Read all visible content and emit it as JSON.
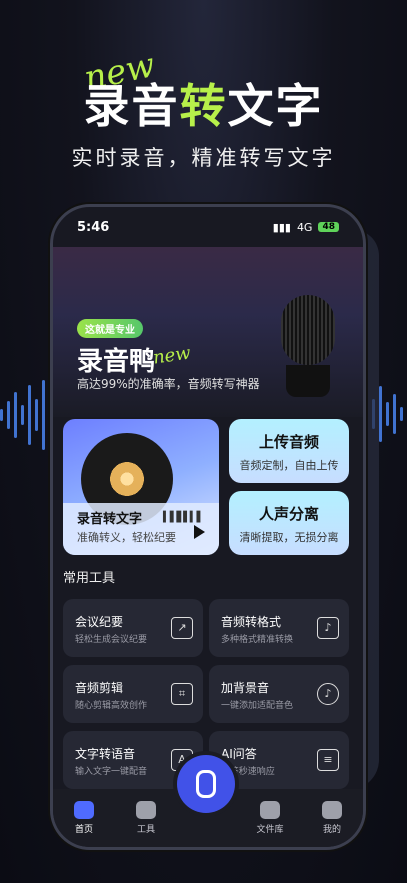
{
  "promo": {
    "title_prefix": "录音",
    "title_accent": "转",
    "title_suffix": "文字",
    "new_badge": "new",
    "subtitle": "实时录音，精准转写文字"
  },
  "status": {
    "time": "5:46",
    "network": "4G",
    "battery": "48"
  },
  "banner": {
    "tag": "这就是专业",
    "app_name": "录音鸭",
    "new_badge": "new",
    "desc": "高达99%的准确率，音频转写神器"
  },
  "features": {
    "main": {
      "title": "录音转文字",
      "subtitle": "准确转义，轻松纪要"
    },
    "upload": {
      "title": "上传音频",
      "subtitle": "音频定制，自由上传"
    },
    "separate": {
      "title": "人声分离",
      "subtitle": "清晰提取，无损分离"
    }
  },
  "tools_section": {
    "title": "常用工具"
  },
  "tools": [
    {
      "title": "会议纪要",
      "subtitle": "轻松生成会议纪要",
      "icon": "chart-board-icon"
    },
    {
      "title": "音频转格式",
      "subtitle": "多种格式精准转换",
      "icon": "music-file-icon"
    },
    {
      "title": "音频剪辑",
      "subtitle": "随心剪辑高效创作",
      "icon": "crop-icon"
    },
    {
      "title": "加背景音",
      "subtitle": "一键添加适配音色",
      "icon": "music-note-icon"
    },
    {
      "title": "文字转语音",
      "subtitle": "输入文字一键配音",
      "icon": "text-voice-icon"
    },
    {
      "title": "AI问答",
      "subtitle": "AI答秒速响应",
      "icon": "chat-icon"
    }
  ],
  "tabs": [
    {
      "label": "首页",
      "icon": "home-icon",
      "active": true
    },
    {
      "label": "工具",
      "icon": "wrench-icon",
      "active": false
    },
    {
      "label": "文件库",
      "icon": "folder-icon",
      "active": false
    },
    {
      "label": "我的",
      "icon": "user-icon",
      "active": false
    }
  ],
  "colors": {
    "accent_green": "#b7f04a",
    "accent_blue": "#4152e8"
  }
}
